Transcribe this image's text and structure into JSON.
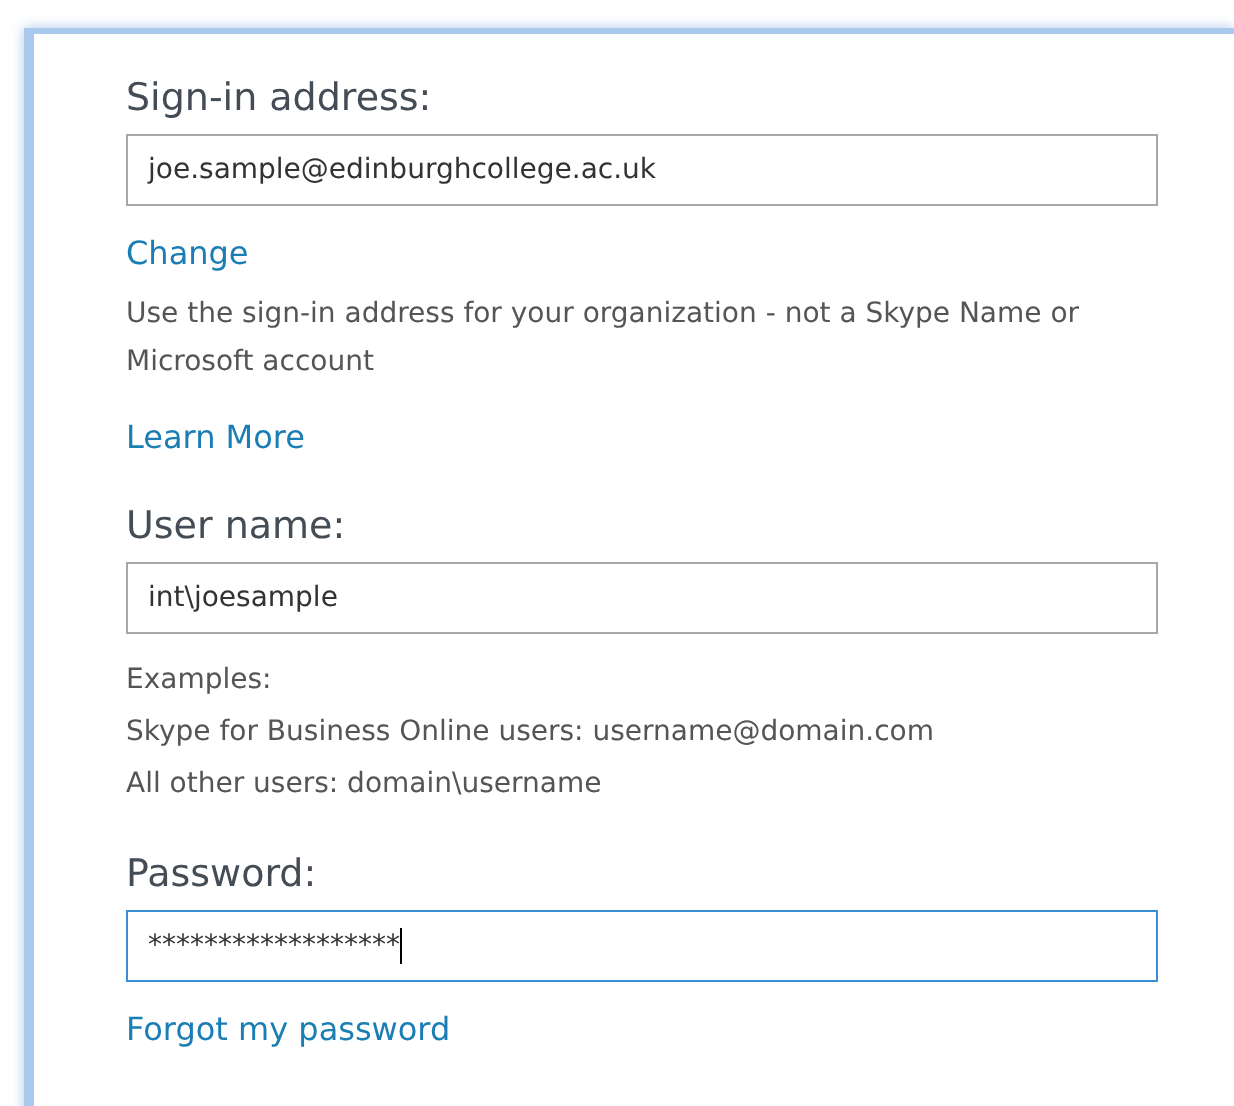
{
  "sections": [
    {
      "label": "Sign-in address:",
      "field": {
        "value": "joe.sample@edinburghcollege.ac.uk",
        "focused": false
      },
      "links_after_field": [
        {
          "text": "Change"
        }
      ],
      "help": [
        "Use the sign-in address for your organization - not a Skype Name or Microsoft account"
      ],
      "links_after_help": [
        {
          "text": "Learn More"
        }
      ]
    },
    {
      "label": "User name:",
      "field": {
        "value": "int\\joesample",
        "focused": false
      },
      "help": [
        "Examples:",
        "Skype for Business Online users: username@domain.com",
        "All other users: domain\\username"
      ]
    },
    {
      "label": "Password:",
      "field": {
        "value": "******************",
        "focused": true
      },
      "links_after_field": [
        {
          "text": "Forgot my password"
        }
      ]
    }
  ]
}
